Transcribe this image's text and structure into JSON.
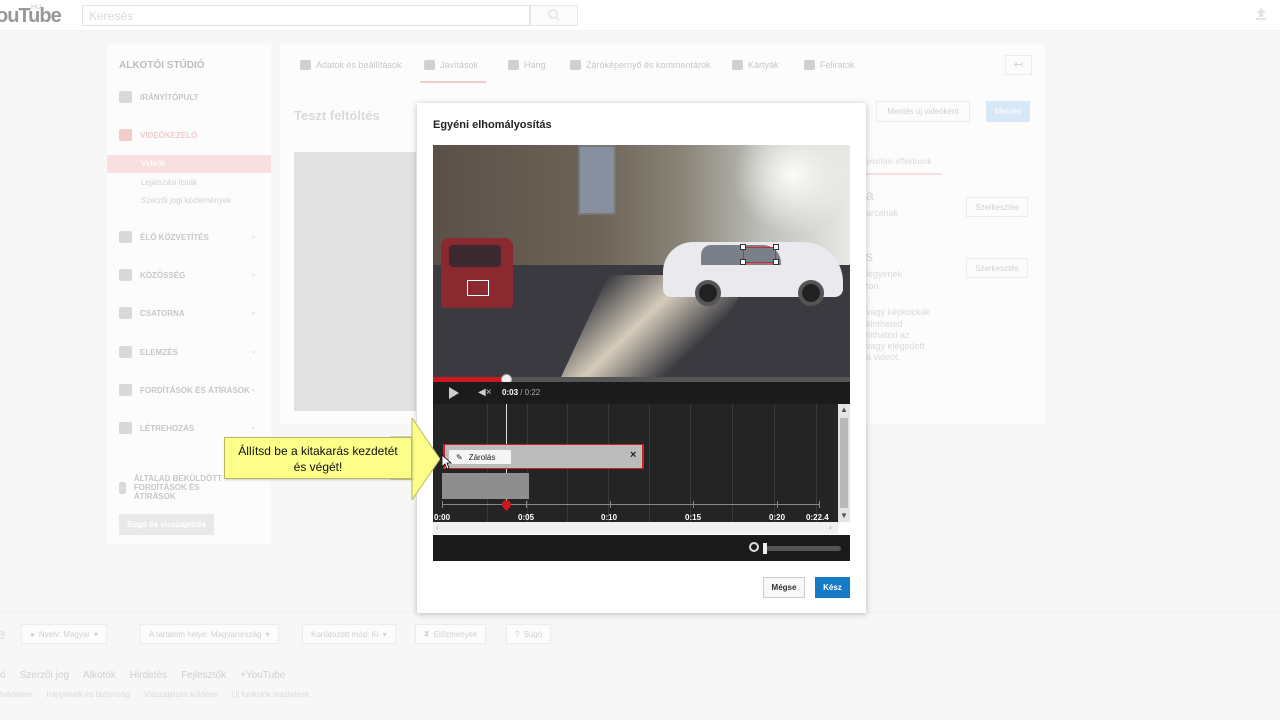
{
  "topbar": {
    "logo": "ouTube",
    "logo_country": "HU",
    "search_placeholder": "Keresés"
  },
  "sidebar": {
    "title": "ALKOTÓI STÚDIÓ",
    "items": [
      {
        "label": "IRÁNYÍTÓPULT"
      },
      {
        "label": "VIDEÓKEZELŐ"
      },
      {
        "label": "ÉLŐ KÖZVETÍTÉS"
      },
      {
        "label": "KÖZÖSSÉG"
      },
      {
        "label": "CSATORNA"
      },
      {
        "label": "ELEMZÉS"
      },
      {
        "label": "FORDÍTÁSOK ÉS ÁTÍRÁSOK"
      },
      {
        "label": "LÉTREHOZÁS"
      },
      {
        "label": "ÁLTALAD BEKÜLDÖTT FORDÍTÁSOK ÉS ÁTÍRÁSOK"
      }
    ],
    "sub_items": [
      "Videók",
      "Lejátszási listák",
      "Szerzői jogi közlemények"
    ],
    "help_button": "Súgó és visszajelzés"
  },
  "tabs": [
    {
      "label": "Adatok és beállítások"
    },
    {
      "label": "Javítások"
    },
    {
      "label": "Hang"
    },
    {
      "label": "Záróképernyő és kommentárok"
    },
    {
      "label": "Kártyák"
    },
    {
      "label": "Feliratok"
    }
  ],
  "main": {
    "page_title": "Teszt feltöltés",
    "save_new_label": "Mentés új videóként",
    "save_label": "Mentés",
    "right_tab": "yosítási effektusok",
    "right_big_a": "a",
    "right_text_a": "arcanak",
    "right_big_b": "s",
    "right_text_b1": "legyenek",
    "right_text_b2": "ton.",
    "right_text_c1": "vagy képkockák",
    "right_text_c2": "kintheted",
    "right_text_c3": "llíthatod az",
    "right_text_c4": "vagy elégedett",
    "right_text_c5": "a videót.",
    "edit_label": "Szerkesztés"
  },
  "dialog": {
    "title": "Egyéni elhomályosítás",
    "time_current": "0:03",
    "time_total": " / 0:22",
    "clip_label": "Zárolás",
    "ticks": [
      "0:00",
      "0:05",
      "0:10",
      "0:15",
      "0:20",
      "0:22.4"
    ],
    "cancel_label": "Mégse",
    "done_label": "Kész"
  },
  "callout": {
    "line1": "Állítsd be a kitakarás kezdetét",
    "line2": "és végét!"
  },
  "footer": {
    "logo": "e",
    "language": "Nyelv: Magyar",
    "location": "A tartalom helye: Magyarország",
    "restricted": "Korlátozott mód: Ki",
    "history": "Előzmények",
    "help": "Súgó",
    "links": [
      "ó",
      "Szerzői jog",
      "Alkotók",
      "Hirdetés",
      "Fejlesztők",
      "+YouTube"
    ],
    "links2": [
      "tvédelem",
      "Irányelvek és biztonság",
      "Visszajelzés küldése",
      "Új funkciók tesztelése"
    ]
  },
  "colors": {
    "accent_red": "#cc181e",
    "done_blue": "#167ac6",
    "callout_yellow": "#fdfd8a"
  }
}
